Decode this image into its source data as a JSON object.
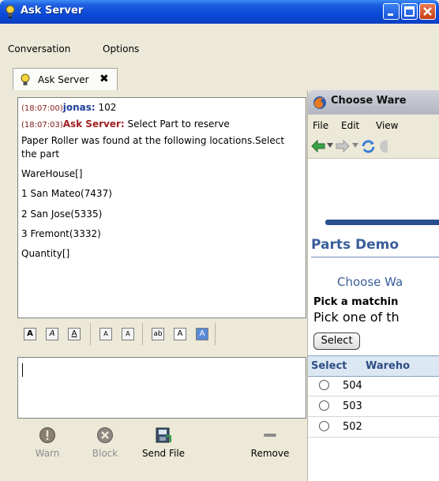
{
  "window": {
    "title": "Ask Server",
    "buttons": [
      "minimize",
      "maximize",
      "close"
    ]
  },
  "menu": {
    "conversation": "Conversation",
    "options": "Options"
  },
  "tab": {
    "label": "Ask Server",
    "close": "✖"
  },
  "chat": {
    "messages": [
      {
        "time": "(18:07:00)",
        "nick": "jonas:",
        "text": " 102"
      },
      {
        "time": "(18:07:03)",
        "nick": "Ask Server:",
        "text": " Select Part to reserve"
      }
    ],
    "lines": [
      "Paper Roller was found at the following locations.Select",
      "the part",
      "WareHouse[]",
      " 1 San Mateo(7437)",
      " 2 San Jose(5335)",
      " 3 Fremont(3332)",
      "Quantity[]"
    ]
  },
  "actions": {
    "warn": "Warn",
    "block": "Block",
    "send_file": "Send File",
    "remove": "Remove"
  },
  "browser": {
    "title": "Choose Ware",
    "menu": {
      "file": "File",
      "edit": "Edit",
      "view": "View"
    },
    "page_title": "Parts Demo",
    "subtitle": "Choose Wa",
    "pick_bold": "Pick a matchin",
    "pick_text": "Pick one of th",
    "select_button": "Select",
    "table": {
      "headers": [
        "Select",
        "Wareho"
      ],
      "rows": [
        "504",
        "503",
        "502"
      ]
    }
  }
}
